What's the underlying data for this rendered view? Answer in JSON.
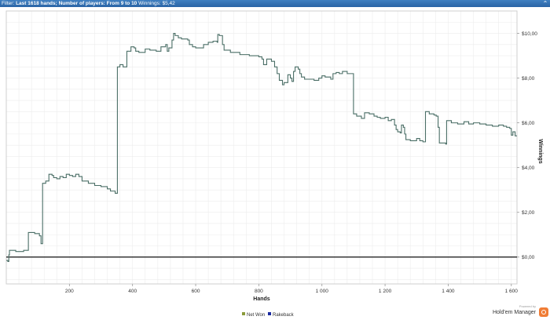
{
  "window": {
    "filter_label": "Filter: ",
    "filter_text": "Last 1618 hands; Number of players: From 9 to 10",
    "winnings_text": "  Winnings: $5,42"
  },
  "logo": {
    "powered": "Powered by",
    "name": "Hold'em Manager"
  },
  "chart_data": {
    "type": "line",
    "xlabel": "Hands",
    "ylabel": "Winnings",
    "xlim": [
      0,
      1618
    ],
    "ylim": [
      -1.2,
      11.0
    ],
    "grid": true,
    "legend_position": "bottom-center",
    "x_ticks": [
      {
        "value": 200,
        "label": "200"
      },
      {
        "value": 400,
        "label": "400"
      },
      {
        "value": 600,
        "label": "600"
      },
      {
        "value": 800,
        "label": "800"
      },
      {
        "value": 1000,
        "label": "1 000"
      },
      {
        "value": 1200,
        "label": "1 200"
      },
      {
        "value": 1400,
        "label": "1 400"
      },
      {
        "value": 1600,
        "label": "1 600"
      }
    ],
    "y_ticks": [
      {
        "value": 0,
        "label": "$0,00"
      },
      {
        "value": 2,
        "label": "$2,00"
      },
      {
        "value": 4,
        "label": "$4,00"
      },
      {
        "value": 6,
        "label": "$6,00"
      },
      {
        "value": 8,
        "label": "$8,00"
      },
      {
        "value": 10,
        "label": "$10,00"
      }
    ],
    "series": [
      {
        "name": "Net Won",
        "color": "#4a6e66",
        "points": [
          [
            0,
            -0.15
          ],
          [
            5,
            -0.2
          ],
          [
            8,
            0.1
          ],
          [
            10,
            0.3
          ],
          [
            20,
            0.3
          ],
          [
            30,
            0.25
          ],
          [
            45,
            0.25
          ],
          [
            55,
            0.3
          ],
          [
            68,
            0.3
          ],
          [
            70,
            1.1
          ],
          [
            90,
            1.05
          ],
          [
            105,
            0.95
          ],
          [
            110,
            0.6
          ],
          [
            112,
            0.6
          ],
          [
            115,
            3.3
          ],
          [
            125,
            3.4
          ],
          [
            135,
            3.7
          ],
          [
            145,
            3.65
          ],
          [
            150,
            3.55
          ],
          [
            160,
            3.5
          ],
          [
            170,
            3.6
          ],
          [
            180,
            3.55
          ],
          [
            190,
            3.7
          ],
          [
            200,
            3.65
          ],
          [
            210,
            3.6
          ],
          [
            220,
            3.7
          ],
          [
            230,
            3.6
          ],
          [
            240,
            3.4
          ],
          [
            260,
            3.3
          ],
          [
            280,
            3.2
          ],
          [
            300,
            3.15
          ],
          [
            320,
            3.05
          ],
          [
            330,
            2.95
          ],
          [
            345,
            2.85
          ],
          [
            352,
            8.5
          ],
          [
            360,
            8.6
          ],
          [
            370,
            8.5
          ],
          [
            378,
            8.5
          ],
          [
            382,
            9.2
          ],
          [
            395,
            9.4
          ],
          [
            405,
            9.35
          ],
          [
            410,
            9.2
          ],
          [
            420,
            9.15
          ],
          [
            440,
            9.3
          ],
          [
            455,
            9.25
          ],
          [
            475,
            9.2
          ],
          [
            490,
            9.4
          ],
          [
            505,
            9.5
          ],
          [
            510,
            9.2
          ],
          [
            515,
            9.35
          ],
          [
            525,
            9.7
          ],
          [
            530,
            10.0
          ],
          [
            535,
            9.9
          ],
          [
            545,
            9.8
          ],
          [
            555,
            9.75
          ],
          [
            575,
            9.7
          ],
          [
            580,
            9.5
          ],
          [
            590,
            9.4
          ],
          [
            600,
            9.35
          ],
          [
            615,
            9.35
          ],
          [
            625,
            9.5
          ],
          [
            640,
            9.6
          ],
          [
            655,
            9.65
          ],
          [
            668,
            9.6
          ],
          [
            670,
            9.95
          ],
          [
            675,
            9.9
          ],
          [
            685,
            9.5
          ],
          [
            690,
            9.25
          ],
          [
            710,
            9.15
          ],
          [
            740,
            9.05
          ],
          [
            770,
            9.0
          ],
          [
            800,
            8.95
          ],
          [
            810,
            8.85
          ],
          [
            815,
            8.6
          ],
          [
            825,
            8.85
          ],
          [
            840,
            8.75
          ],
          [
            850,
            8.5
          ],
          [
            858,
            8.2
          ],
          [
            865,
            7.9
          ],
          [
            875,
            7.7
          ],
          [
            880,
            7.8
          ],
          [
            888,
            7.8
          ],
          [
            892,
            8.15
          ],
          [
            900,
            8.0
          ],
          [
            905,
            7.85
          ],
          [
            910,
            8.3
          ],
          [
            915,
            8.5
          ],
          [
            925,
            8.4
          ],
          [
            930,
            8.2
          ],
          [
            935,
            8.05
          ],
          [
            945,
            7.95
          ],
          [
            965,
            7.95
          ],
          [
            975,
            7.9
          ],
          [
            990,
            8.0
          ],
          [
            1000,
            8.1
          ],
          [
            1010,
            8.05
          ],
          [
            1020,
            8.05
          ],
          [
            1028,
            7.95
          ],
          [
            1035,
            8.2
          ],
          [
            1045,
            8.25
          ],
          [
            1055,
            8.2
          ],
          [
            1065,
            8.3
          ],
          [
            1080,
            8.2
          ],
          [
            1095,
            8.2
          ],
          [
            1100,
            6.4
          ],
          [
            1110,
            6.3
          ],
          [
            1125,
            6.2
          ],
          [
            1135,
            6.45
          ],
          [
            1150,
            6.4
          ],
          [
            1165,
            6.3
          ],
          [
            1175,
            6.25
          ],
          [
            1185,
            6.2
          ],
          [
            1200,
            6.25
          ],
          [
            1210,
            6.1
          ],
          [
            1220,
            6.15
          ],
          [
            1230,
            5.9
          ],
          [
            1235,
            5.7
          ],
          [
            1240,
            5.6
          ],
          [
            1248,
            5.55
          ],
          [
            1252,
            5.9
          ],
          [
            1258,
            5.8
          ],
          [
            1262,
            5.5
          ],
          [
            1266,
            5.25
          ],
          [
            1280,
            5.2
          ],
          [
            1290,
            5.2
          ],
          [
            1300,
            5.3
          ],
          [
            1310,
            5.2
          ],
          [
            1320,
            5.15
          ],
          [
            1328,
            6.5
          ],
          [
            1340,
            6.4
          ],
          [
            1355,
            6.35
          ],
          [
            1362,
            6.3
          ],
          [
            1368,
            5.8
          ],
          [
            1372,
            5.1
          ],
          [
            1385,
            5.1
          ],
          [
            1392,
            5.05
          ],
          [
            1395,
            6.1
          ],
          [
            1410,
            6.0
          ],
          [
            1430,
            5.95
          ],
          [
            1450,
            6.05
          ],
          [
            1465,
            5.95
          ],
          [
            1480,
            6.0
          ],
          [
            1500,
            5.95
          ],
          [
            1520,
            5.9
          ],
          [
            1540,
            5.85
          ],
          [
            1560,
            5.9
          ],
          [
            1575,
            5.85
          ],
          [
            1585,
            5.8
          ],
          [
            1595,
            5.75
          ],
          [
            1600,
            5.45
          ],
          [
            1605,
            5.6
          ],
          [
            1612,
            5.42
          ],
          [
            1618,
            5.42
          ]
        ]
      },
      {
        "name": "Rakeback",
        "color": "#1a2aa0",
        "points": [
          [
            0,
            0
          ],
          [
            1618,
            0
          ]
        ]
      }
    ]
  }
}
